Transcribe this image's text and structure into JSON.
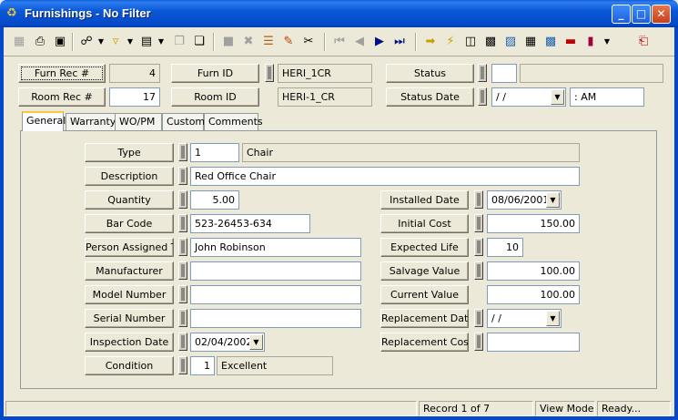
{
  "window": {
    "title": "Furnishings - No Filter"
  },
  "header": {
    "furn_rec_label": "Furn Rec #",
    "furn_rec_value": "4",
    "room_rec_label": "Room Rec #",
    "room_rec_value": "17",
    "furn_id_label": "Furn ID",
    "furn_id_value": "HERI_1CR",
    "room_id_label": "Room ID",
    "room_id_value": "HERI-1_CR",
    "status_label": "Status",
    "status_code": "",
    "status_value": "",
    "status_date_label": "Status Date",
    "status_date_value": " / /",
    "status_time_value": " :  AM"
  },
  "tabs": [
    "General",
    "Warranty",
    "WO/PM",
    "Custom",
    "Comments"
  ],
  "general": {
    "type_label": "Type",
    "type_code": "1",
    "type_value": "Chair",
    "description_label": "Description",
    "description_value": "Red Office Chair",
    "quantity_label": "Quantity",
    "quantity_value": "5.00",
    "barcode_label": "Bar Code",
    "barcode_value": "523-26453-634",
    "person_label": "Person Assigned To",
    "person_value": "John Robinson",
    "manufacturer_label": "Manufacturer",
    "manufacturer_value": "",
    "model_label": "Model Number",
    "model_value": "",
    "serial_label": "Serial Number",
    "serial_value": "",
    "inspection_label": "Inspection Date",
    "inspection_value": "02/04/2002",
    "condition_label": "Condition",
    "condition_code": "1",
    "condition_value": "Excellent",
    "installed_label": "Installed Date",
    "installed_value": "08/06/2001",
    "initial_cost_label": "Initial Cost",
    "initial_cost_value": "150.00",
    "expected_life_label": "Expected Life",
    "expected_life_value": "10",
    "salvage_label": "Salvage Value",
    "salvage_value": "100.00",
    "current_value_label": "Current Value",
    "current_value_value": "100.00",
    "replacement_date_label": "Replacement Date",
    "replacement_date_value": " / /",
    "replacement_cost_label": "Replacement Cost",
    "replacement_cost_value": ""
  },
  "status_bar": {
    "record": "Record 1 of 7",
    "mode": "View Mode",
    "state": "Ready..."
  }
}
